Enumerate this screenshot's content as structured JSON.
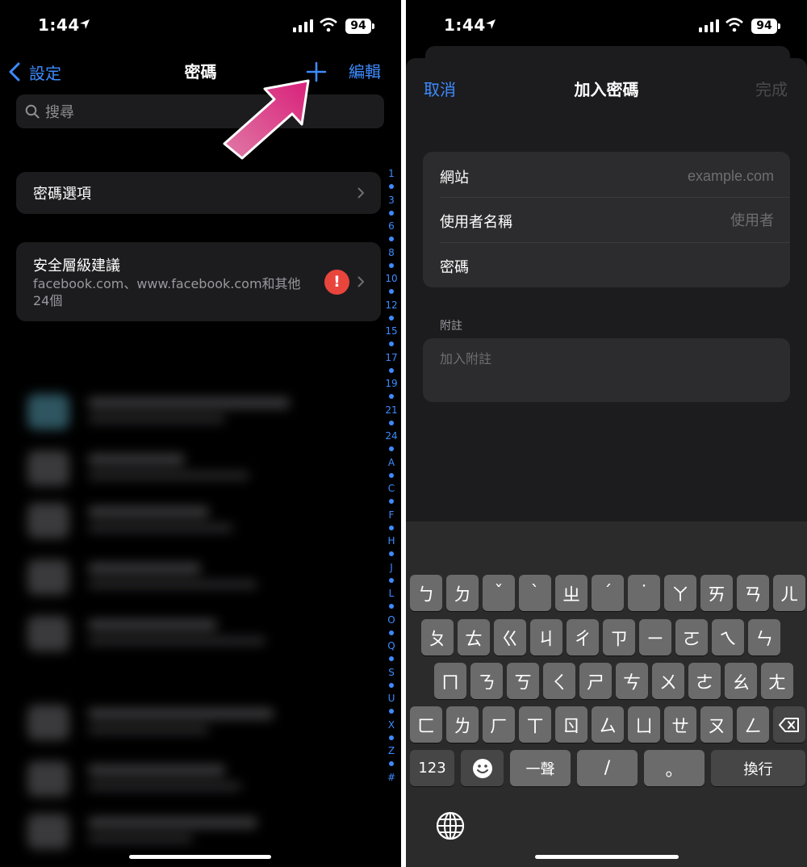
{
  "status_bar": {
    "time": "1:44",
    "battery": "94"
  },
  "left": {
    "nav": {
      "back_label": "設定",
      "title": "密碼",
      "edit_label": "編輯"
    },
    "search": {
      "placeholder": "搜尋"
    },
    "password_options": {
      "label": "密碼選項"
    },
    "security_recommendations": {
      "title": "安全層級建議",
      "description": "facebook.com、www.facebook.com和其他24個",
      "badge": "!"
    },
    "index": [
      "1",
      "3",
      "6",
      "8",
      "10",
      "12",
      "15",
      "17",
      "19",
      "21",
      "24",
      "A",
      "C",
      "F",
      "H",
      "J",
      "L",
      "O",
      "Q",
      "S",
      "U",
      "X",
      "Z",
      "#"
    ]
  },
  "right": {
    "nav": {
      "cancel_label": "取消",
      "title": "加入密碼",
      "done_label": "完成"
    },
    "fields": {
      "website": {
        "label": "網站",
        "placeholder": "example.com"
      },
      "username": {
        "label": "使用者名稱",
        "placeholder": "使用者"
      },
      "password": {
        "label": "密碼",
        "placeholder": ""
      }
    },
    "notes": {
      "label": "附註",
      "placeholder": "加入附註"
    },
    "keyboard": {
      "row1": [
        "ㄅ",
        "ㄉ",
        "ˇ",
        "ˋ",
        "ㄓ",
        "ˊ",
        "˙",
        "ㄚ",
        "ㄞ",
        "ㄢ",
        "ㄦ"
      ],
      "row2": [
        "ㄆ",
        "ㄊ",
        "ㄍ",
        "ㄐ",
        "ㄔ",
        "ㄗ",
        "ㄧ",
        "ㄛ",
        "ㄟ",
        "ㄣ"
      ],
      "row3": [
        "ㄇ",
        "ㄋ",
        "ㄎ",
        "ㄑ",
        "ㄕ",
        "ㄘ",
        "ㄨ",
        "ㄜ",
        "ㄠ",
        "ㄤ"
      ],
      "row4": [
        "ㄈ",
        "ㄌ",
        "ㄏ",
        "ㄒ",
        "ㄖ",
        "ㄙ",
        "ㄩ",
        "ㄝ",
        "ㄡ",
        "ㄥ"
      ],
      "numbers_label": "123",
      "tone_label": "一聲",
      "slash_label": "/",
      "period_label": "。",
      "return_label": "換行"
    }
  }
}
